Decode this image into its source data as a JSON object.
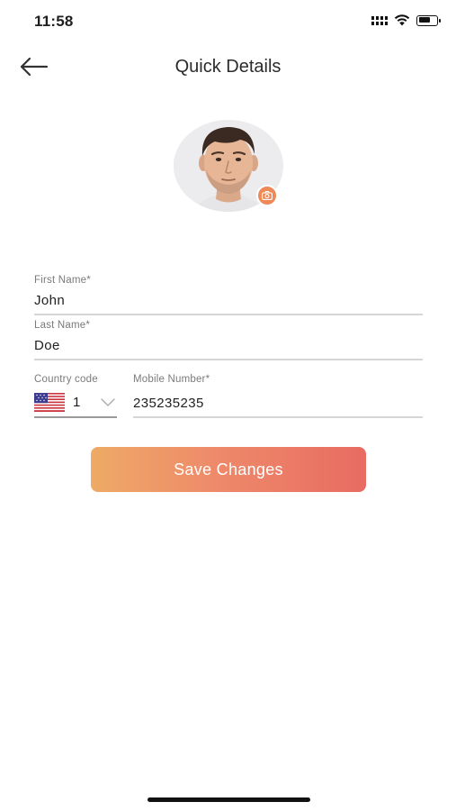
{
  "status_bar": {
    "time": "11:58",
    "battery_level": 0.7,
    "icons": [
      "cellular-signal-icon",
      "wifi-icon",
      "battery-icon"
    ]
  },
  "header": {
    "title": "Quick Details",
    "back_icon": "arrow-left-icon"
  },
  "profile": {
    "avatar": "profile-photo",
    "camera_icon": "camera-icon"
  },
  "form": {
    "first_name": {
      "label": "First Name*",
      "value": "John"
    },
    "last_name": {
      "label": "Last Name*",
      "value": "Doe"
    },
    "country_code": {
      "label": "Country code",
      "value": "1",
      "flag": "us-flag-icon"
    },
    "mobile_number": {
      "label": "Mobile Number*",
      "value": "235235235"
    }
  },
  "actions": {
    "save_label": "Save Changes"
  },
  "colors": {
    "accent_start": "#eeaa66",
    "accent_end": "#e86b62",
    "camera_badge": "#ee8a58",
    "text": "#1f1f1f",
    "label": "#7a7a7a",
    "divider": "#d6d6d6"
  }
}
